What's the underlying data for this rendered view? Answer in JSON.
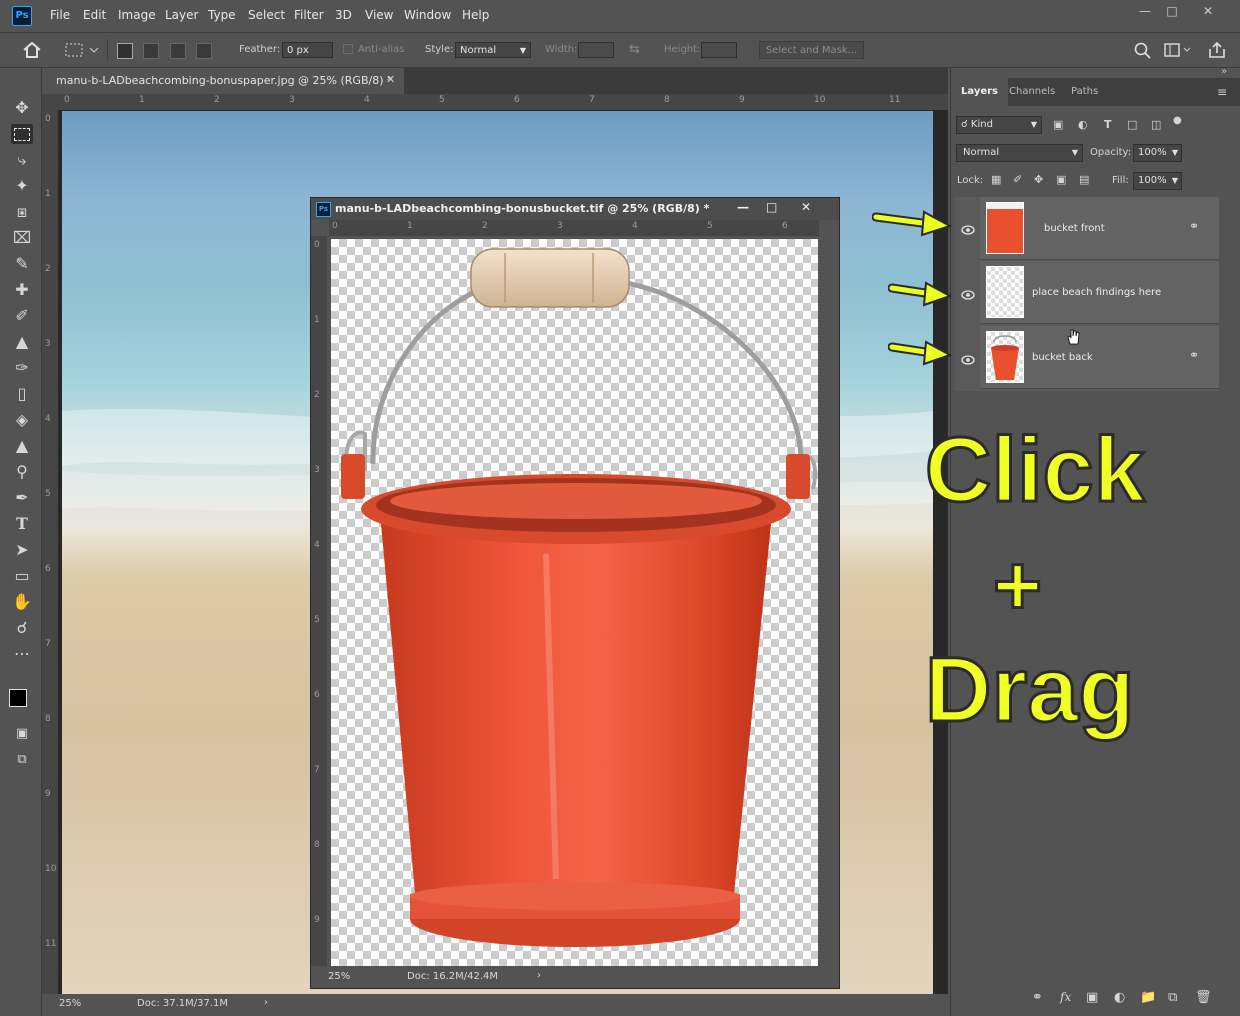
{
  "app": {
    "logo": "Ps"
  },
  "menu": [
    "File",
    "Edit",
    "Image",
    "Layer",
    "Type",
    "Select",
    "Filter",
    "3D",
    "View",
    "Window",
    "Help"
  ],
  "window_controls": [
    "minimize",
    "restore",
    "close"
  ],
  "options": {
    "feather_label": "Feather:",
    "feather_value": "0 px",
    "antialias_label": "Anti-alias",
    "style_label": "Style:",
    "style_value": "Normal",
    "width_label": "Width:",
    "height_label": "Height:",
    "select_mask": "Select and Mask..."
  },
  "main_doc": {
    "tab_title": "manu-b-LADbeachcombing-bonuspaper.jpg @ 25% (RGB/8) *",
    "zoom": "25%",
    "doc_info": "Doc: 37.1M/37.1M",
    "ruler_numbers": [
      "0",
      "1",
      "2",
      "3",
      "4",
      "5",
      "6",
      "7",
      "8",
      "9",
      "10",
      "11"
    ],
    "vruler_numbers": [
      "0",
      "1",
      "2",
      "3",
      "4",
      "5",
      "6",
      "7",
      "8",
      "9",
      "10",
      "11"
    ]
  },
  "float_doc": {
    "title": "manu-b-LADbeachcombing-bonusbucket.tif @ 25% (RGB/8) *",
    "zoom": "25%",
    "doc_info": "Doc: 16.2M/42.4M",
    "ruler_numbers": [
      "0",
      "1",
      "2",
      "3",
      "4",
      "5",
      "6"
    ],
    "vruler_numbers": [
      "0",
      "1",
      "2",
      "3",
      "4",
      "5",
      "6",
      "7",
      "8",
      "9"
    ]
  },
  "panel": {
    "tabs": [
      "Layers",
      "Channels",
      "Paths"
    ],
    "kind_label": "Kind",
    "blend_mode": "Normal",
    "opacity_label": "Opacity:",
    "opacity_value": "100%",
    "lock_label": "Lock:",
    "fill_label": "Fill:",
    "fill_value": "100%",
    "layers": [
      {
        "name": "bucket front"
      },
      {
        "name": "place beach findings here"
      },
      {
        "name": "bucket back"
      }
    ]
  },
  "overlay": {
    "line1": "Click",
    "line2": "+",
    "line3": "Drag"
  },
  "colors": {
    "accent_yellow": "#f0ff24",
    "bucket_red": "#e8502e",
    "ui_bg": "#535353"
  }
}
